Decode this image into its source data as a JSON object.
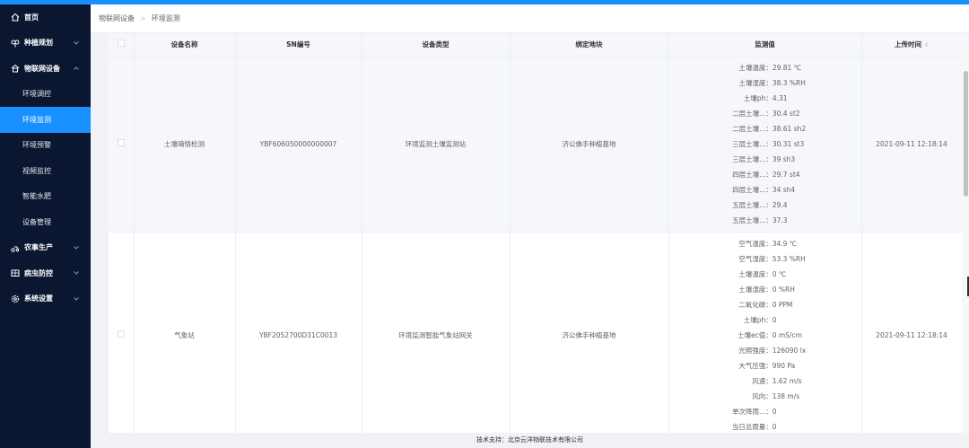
{
  "sidebar": {
    "items": [
      {
        "label": "首页",
        "icon": "home-icon",
        "has_chevron": false
      },
      {
        "label": "种植规划",
        "icon": "plant-icon",
        "has_chevron": true
      },
      {
        "label": "物联网设备",
        "icon": "device-icon",
        "has_chevron": true,
        "expanded": true,
        "children": [
          {
            "label": "环境调控",
            "active": false
          },
          {
            "label": "环境监测",
            "active": true
          },
          {
            "label": "环境预警",
            "active": false
          },
          {
            "label": "视频监控",
            "active": false
          },
          {
            "label": "智能水肥",
            "active": false
          },
          {
            "label": "设备管理",
            "active": false
          }
        ]
      },
      {
        "label": "农事生产",
        "icon": "tractor-icon",
        "has_chevron": true
      },
      {
        "label": "病虫防控",
        "icon": "bug-icon",
        "has_chevron": true
      },
      {
        "label": "系统设置",
        "icon": "gear-icon",
        "has_chevron": true
      }
    ]
  },
  "breadcrumb": {
    "parent": "物联网设备",
    "separator": ">",
    "current": "环境监测"
  },
  "table": {
    "columns": [
      "设备名称",
      "SN编号",
      "设备类型",
      "绑定地块",
      "监测值",
      "上传时间"
    ],
    "sort_glyph": "⇕",
    "rows": [
      {
        "name": "土壤墒情检测",
        "sn": "YBF606050000000007",
        "type": "环境监测土壤监测站",
        "plot": "济公佛手种植基地",
        "metrics": [
          {
            "label": "土壤温度：",
            "value": "29.81 ℃"
          },
          {
            "label": "土壤湿度：",
            "value": "38.3 %RH"
          },
          {
            "label": "土壤ph：",
            "value": "4.31"
          },
          {
            "label": "二层土壤...：",
            "value": "30.4 st2"
          },
          {
            "label": "二层土壤...：",
            "value": "38.61 sh2"
          },
          {
            "label": "三层土壤...：",
            "value": "30.31 st3"
          },
          {
            "label": "三层土壤...：",
            "value": "39 sh3"
          },
          {
            "label": "四层土壤...：",
            "value": "29.7 st4"
          },
          {
            "label": "四层土壤...：",
            "value": "34 sh4"
          },
          {
            "label": "五层土壤...：",
            "value": "29.4"
          },
          {
            "label": "五层土壤...：",
            "value": "37.3"
          }
        ],
        "time": "2021-09-11 12:18:14"
      },
      {
        "name": "气象站",
        "sn": "YBF2052700D31C0013",
        "type": "环境监测智能气象站网关",
        "plot": "济公佛手种植基地",
        "metrics": [
          {
            "label": "空气温度：",
            "value": "34.9 ℃"
          },
          {
            "label": "空气湿度：",
            "value": "53.3 %RH"
          },
          {
            "label": "土壤温度：",
            "value": "0 ℃"
          },
          {
            "label": "土壤湿度：",
            "value": "0 %RH"
          },
          {
            "label": "二氧化碳：",
            "value": "0 PPM"
          },
          {
            "label": "土壤ph：",
            "value": "0"
          },
          {
            "label": "土壤ec值：",
            "value": "0 mS/cm"
          },
          {
            "label": "光照强度：",
            "value": "126090 lx"
          },
          {
            "label": "大气压强：",
            "value": "990 Pa"
          },
          {
            "label": "风速：",
            "value": "1.62 m/s"
          },
          {
            "label": "风向：",
            "value": "138 m/s"
          },
          {
            "label": "单次降雨...：",
            "value": "0"
          },
          {
            "label": "当日总雨量：",
            "value": "0"
          }
        ],
        "time": "2021-09-11 12:18:14"
      }
    ]
  },
  "footer": {
    "text": "技术支持：北京云洋物联技术有限公司"
  },
  "colors": {
    "sidebar_bg": "#0b1730",
    "accent": "#1890ff"
  }
}
